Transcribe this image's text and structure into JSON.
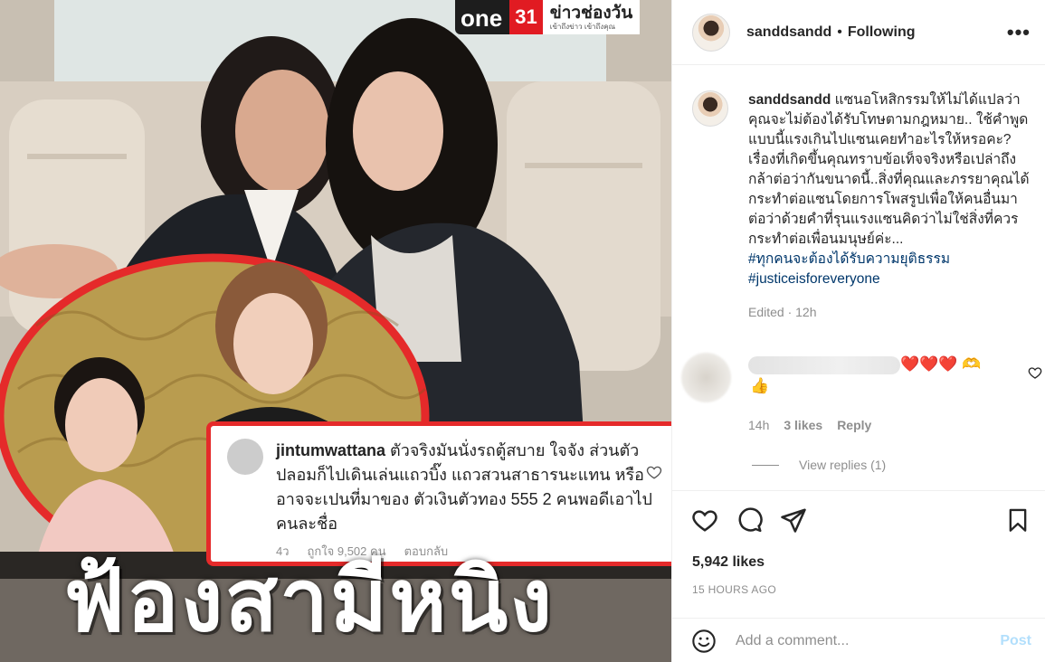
{
  "media": {
    "logo_one": "one",
    "logo_31": "31",
    "logo_news": "ข่าวช่องวัน",
    "logo_news_sub": "เข้าถึงข่าว เข้าถึงคุณ",
    "headline": "ฟ้องสามีหนิง",
    "embedded_comment": {
      "username": "jintumwattana",
      "text": "ตัวจริงมันนั่งรถตู้สบาย ใจจัง ส่วนตัวปลอมก็ไปเดินเล่นแถวบิ๊ง แถวสวนสาธารนะแทน หรืออาจจะเปนที่มาของ ตัวเงินตัวทอง 555 2 คนพอดีเอาไปคนละชื่อ",
      "time": "4ว",
      "likes": "ถูกใจ 9,502 คน",
      "reply": "ตอบกลับ"
    }
  },
  "header": {
    "username": "sanddsandd",
    "dot": "•",
    "following": "Following",
    "more": "•••"
  },
  "caption": {
    "username": "sanddsandd",
    "text": "แซนอโหสิกรรมให้ไม่ได้แปลว่าคุณจะไม่ต้องได้รับโทษตามกฎหมาย.. ใช้คำพูดแบบนี้แรงเกินไปแซนเคยทำอะไรให้หรอคะ? เรื่องที่เกิดขึ้นคุณทราบข้อเท็จจริงหรือเปล่าถึงกล้าต่อว่ากันขนาดนี้..สิ่งที่คุณและภรรยาคุณได้กระทำต่อแซนโดยการโพสรูปเพื่อให้คนอื่นมาต่อว่าด้วยคำที่รุนแรงแซนคิดว่าไม่ใช่สิ่งที่ควรกระทำต่อเพื่อนมนุษย์ค่ะ...",
    "hashtags": [
      "#ทุกคนจะต้องได้รับความยุติธรรม",
      "#justiceisforeveryone"
    ],
    "edited": "Edited · 12h"
  },
  "comment": {
    "emojis": "❤️❤️❤️",
    "wave": "🫶",
    "thumb": "👍",
    "time": "14h",
    "likes": "3 likes",
    "reply": "Reply",
    "view_replies": "View replies (1)"
  },
  "actions": {
    "likes": "5,942 likes",
    "time_ago": "15 HOURS AGO",
    "add_comment_placeholder": "Add a comment...",
    "post": "Post"
  },
  "colors": {
    "accent_red": "#e52a2a",
    "hashtag": "#00376b",
    "post_disabled": "#b2dffc",
    "meta_gray": "#8e8e8e"
  }
}
